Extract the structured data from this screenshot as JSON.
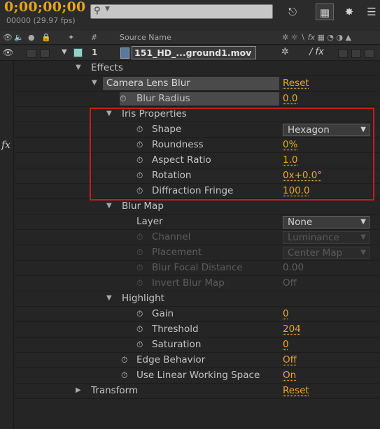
{
  "header": {
    "timecode": "0;00;00;00",
    "frames_fps": "00000 (29.97 fps)",
    "search_placeholder": "",
    "tool_icons": [
      "flowchart-icon",
      "draft-3d-icon",
      "3d-layer-icon"
    ]
  },
  "columns": {
    "number": "#",
    "source_name": "Source Name"
  },
  "layer": {
    "number": "1",
    "name": "151_HD_...ground1.mov",
    "label_color": "#8fd3c9"
  },
  "properties": {
    "effects": {
      "label": "Effects"
    },
    "lens_blur": {
      "label": "Camera Lens Blur",
      "reset": "Reset"
    },
    "blur_radius": {
      "label": "Blur Radius",
      "value": "0.0"
    },
    "iris": {
      "label": "Iris Properties"
    },
    "shape": {
      "label": "Shape",
      "value": "Hexagon"
    },
    "roundness": {
      "label": "Roundness",
      "value": "0%"
    },
    "aspect_ratio": {
      "label": "Aspect Ratio",
      "value": "1.0"
    },
    "rotation": {
      "label": "Rotation",
      "value": "0x+0.0°"
    },
    "diffraction": {
      "label": "Diffraction Fringe",
      "value": "100.0"
    },
    "blur_map": {
      "label": "Blur Map"
    },
    "layer": {
      "label": "Layer",
      "value": "None"
    },
    "channel": {
      "label": "Channel",
      "value": "Luminance"
    },
    "placement": {
      "label": "Placement",
      "value": "Center Map"
    },
    "focal_distance": {
      "label": "Blur Focal Distance",
      "value": "0.00"
    },
    "invert": {
      "label": "Invert Blur Map",
      "value": "Off"
    },
    "highlight": {
      "label": "Highlight"
    },
    "gain": {
      "label": "Gain",
      "value": "0"
    },
    "threshold": {
      "label": "Threshold",
      "value": "204"
    },
    "saturation": {
      "label": "Saturation",
      "value": "0"
    },
    "edge_behavior": {
      "label": "Edge Behavior",
      "value": "Off"
    },
    "linear_ws": {
      "label": "Use Linear Working Space",
      "value": "On"
    },
    "transform": {
      "label": "Transform",
      "reset": "Reset"
    }
  },
  "colors": {
    "accent_value": "#e7a928",
    "highlight_box": "#c41e1e"
  }
}
